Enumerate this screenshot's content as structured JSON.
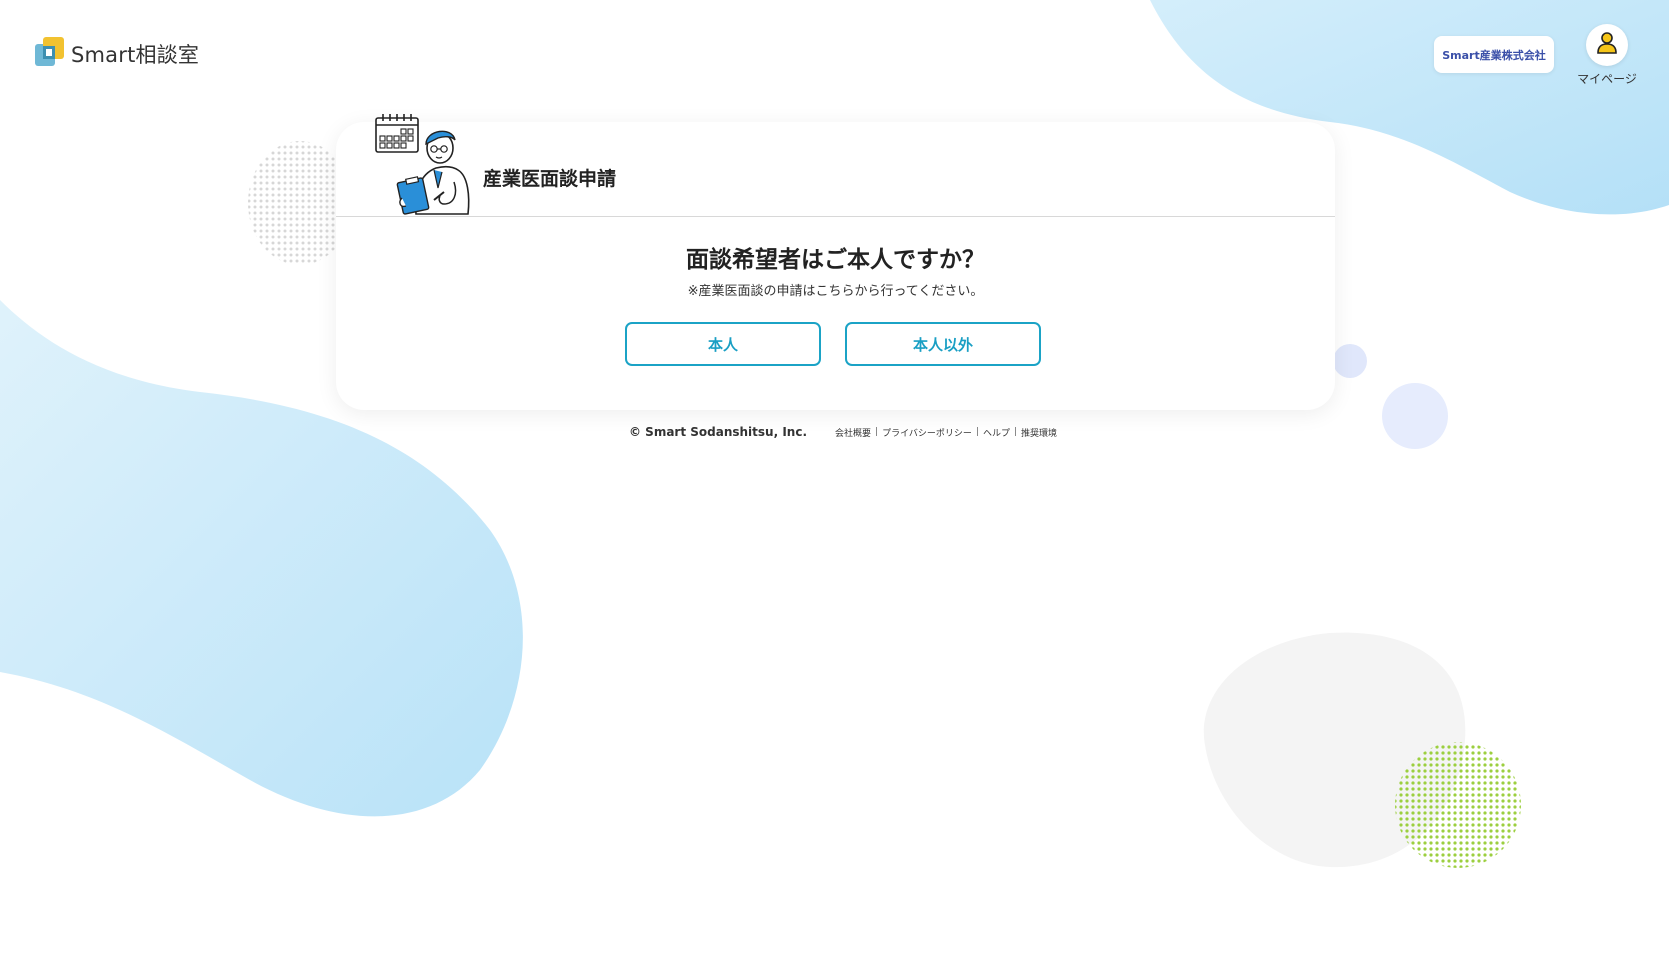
{
  "brand": {
    "logo_text": "Smart相談室"
  },
  "header": {
    "company_name": "Smart産業株式会社",
    "mypage_label": "マイページ"
  },
  "card": {
    "title": "産業医面談申請",
    "question": "面談希望者はご本人ですか？",
    "note": "※産業医面談の申請はこちらから行ってください。",
    "buttons": {
      "self": "本人",
      "other": "本人以外"
    }
  },
  "footer": {
    "copyright": "© Smart Sodanshitsu, Inc.",
    "links": [
      "会社概要",
      "プライバシーポリシー",
      "ヘルプ",
      "推奨環境"
    ],
    "separator": "|"
  },
  "colors": {
    "accent": "#1ba3c6",
    "company_text": "#3a4fa8",
    "blob": "#bfe6f8",
    "dots_green": "#9ccf3f",
    "avatar_yellow": "#f5c518"
  },
  "icons": [
    "logo-mark-icon",
    "user-icon",
    "doctor-illustration"
  ]
}
